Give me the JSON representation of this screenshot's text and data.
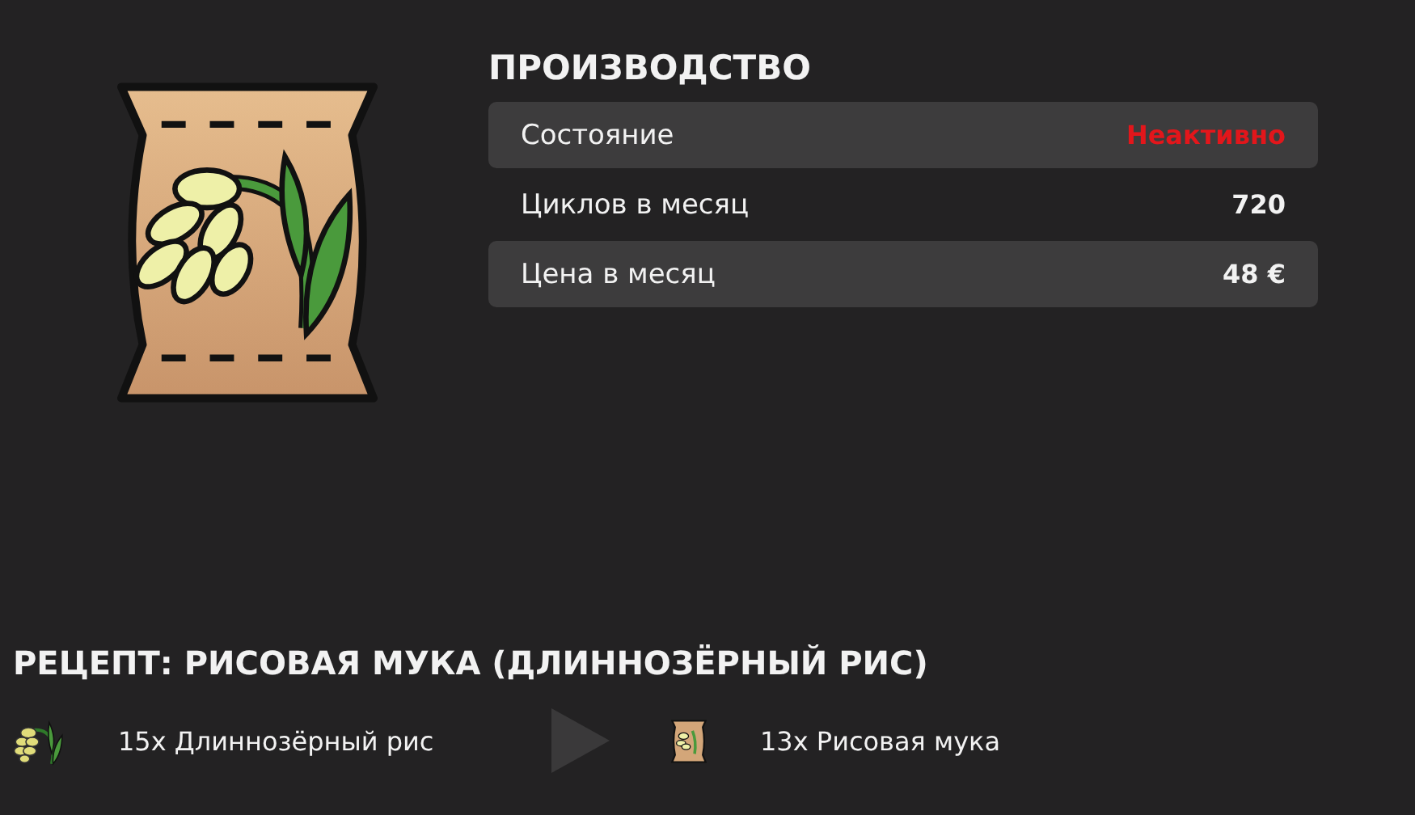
{
  "production": {
    "title": "ПРОИЗВОДСТВО",
    "rows": [
      {
        "label": "Состояние",
        "value": "Неактивно",
        "kind": "alert"
      },
      {
        "label": "Циклов в месяц",
        "value": "720",
        "kind": "normal"
      },
      {
        "label": "Цена в месяц",
        "value": "48 €",
        "kind": "normal"
      }
    ]
  },
  "recipe": {
    "title": "РЕЦЕПТ: РИСОВАЯ МУКА (ДЛИННОЗЁРНЫЙ РИС)",
    "input": {
      "text": "15x Длиннозёрный рис"
    },
    "output": {
      "text": "13x Рисовая мука"
    }
  }
}
